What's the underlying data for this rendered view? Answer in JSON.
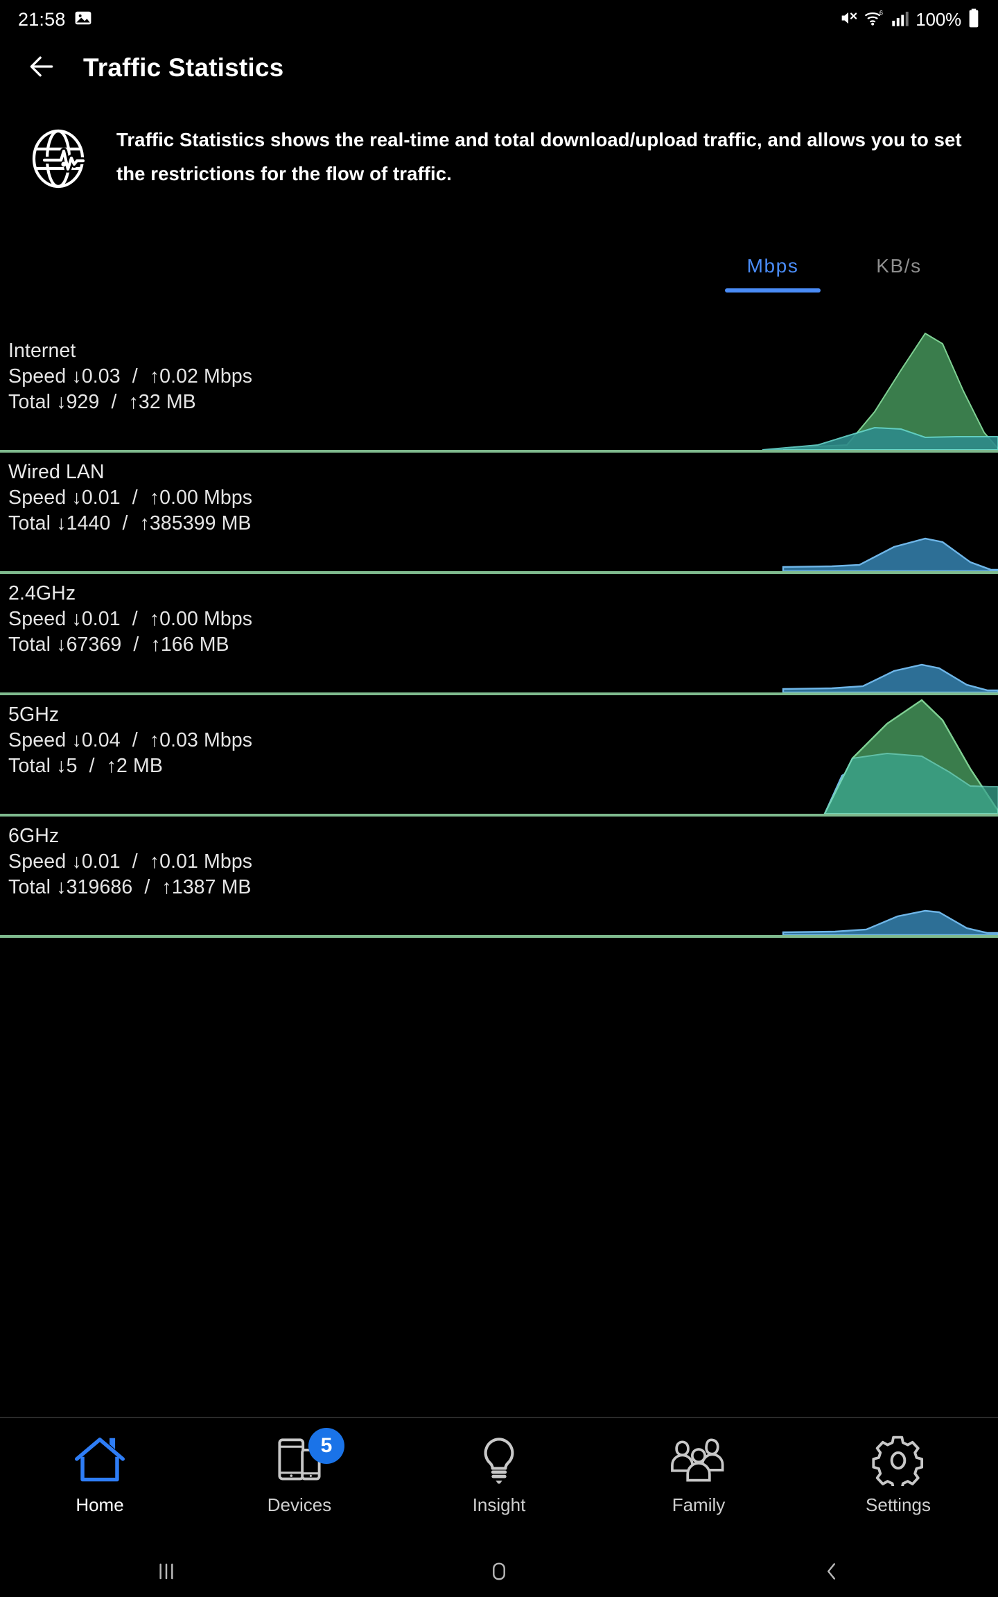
{
  "status_bar": {
    "time": "21:58",
    "left_icons": [
      "image-icon"
    ],
    "right_icons": [
      "mute-icon",
      "wifi-6-icon",
      "cellular-signal-icon"
    ],
    "battery_percent": "100%"
  },
  "app_bar": {
    "back_icon": "back-arrow-icon",
    "title": "Traffic Statistics"
  },
  "description": {
    "icon": "globe-traffic-icon",
    "text": "Traffic Statistics shows the real-time and total download/upload traffic, and allows you to set the restrictions for the flow of traffic."
  },
  "unit_tabs": {
    "active_color": "#4a8cf7",
    "inactive_color": "#8e8e8e",
    "items": [
      {
        "label": "Mbps",
        "active": true
      },
      {
        "label": "KB/s",
        "active": false
      }
    ]
  },
  "labels": {
    "speed": "Speed",
    "total": "Total",
    "separator": "/",
    "down_arrow": "↓",
    "up_arrow": "↑",
    "speed_unit": "Mbps",
    "total_unit": "MB"
  },
  "rows": [
    {
      "name": "Internet",
      "speed_down": "0.03",
      "speed_up": "0.02",
      "speed_unit": "Mbps",
      "total_down": "929",
      "total_up": "32",
      "total_unit": "MB"
    },
    {
      "name": "Wired LAN",
      "speed_down": "0.01",
      "speed_up": "0.00",
      "speed_unit": "Mbps",
      "total_down": "1440",
      "total_up": "385399",
      "total_unit": "MB"
    },
    {
      "name": "2.4GHz",
      "speed_down": "0.01",
      "speed_up": "0.00",
      "speed_unit": "Mbps",
      "total_down": "67369",
      "total_up": "166",
      "total_unit": "MB"
    },
    {
      "name": "5GHz",
      "speed_down": "0.04",
      "speed_up": "0.03",
      "speed_unit": "Mbps",
      "total_down": "5",
      "total_up": "2",
      "total_unit": "MB"
    },
    {
      "name": "6GHz",
      "speed_down": "0.01",
      "speed_up": "0.01",
      "speed_unit": "Mbps",
      "total_down": "319686",
      "total_up": "1387",
      "total_unit": "MB"
    }
  ],
  "chart_data": [
    {
      "type": "area",
      "title": "Internet",
      "x": [
        0,
        1,
        2,
        3,
        4,
        5,
        6,
        7,
        8,
        9,
        10,
        11,
        12
      ],
      "series": [
        {
          "name": "download",
          "color": "#3a7d4c",
          "values": [
            0,
            0,
            0,
            0,
            0,
            0,
            0,
            0,
            0.01,
            0.06,
            0.3,
            0.03,
            0.01
          ]
        },
        {
          "name": "upload",
          "color": "#2e8b8b",
          "values": [
            0,
            0,
            0,
            0,
            0,
            0,
            0,
            0,
            0.005,
            0.02,
            0.04,
            0.02,
            0.015
          ]
        }
      ],
      "ylim": [
        0,
        0.32
      ],
      "grid": false,
      "legend": "none"
    },
    {
      "type": "area",
      "title": "Wired LAN",
      "x": [
        0,
        1,
        2,
        3,
        4,
        5,
        6,
        7,
        8,
        9,
        10,
        11,
        12
      ],
      "series": [
        {
          "name": "download",
          "color": "#3a7d4c",
          "values": [
            0,
            0,
            0,
            0,
            0,
            0,
            0,
            0,
            0,
            0,
            0,
            0,
            0
          ]
        },
        {
          "name": "upload",
          "color": "#2d6f96",
          "values": [
            0.002,
            0.002,
            0.002,
            0.002,
            0.002,
            0.002,
            0.002,
            0.004,
            0.02,
            0.05,
            0.03,
            0.004,
            0.002
          ]
        }
      ],
      "ylim": [
        0,
        0.055
      ],
      "grid": false,
      "legend": "none"
    },
    {
      "type": "area",
      "title": "2.4GHz",
      "x": [
        0,
        1,
        2,
        3,
        4,
        5,
        6,
        7,
        8,
        9,
        10,
        11,
        12
      ],
      "series": [
        {
          "name": "download",
          "color": "#3a7d4c",
          "values": [
            0,
            0,
            0,
            0,
            0,
            0,
            0,
            0,
            0,
            0,
            0,
            0,
            0
          ]
        },
        {
          "name": "upload",
          "color": "#2d6f96",
          "values": [
            0.002,
            0.002,
            0.002,
            0.002,
            0.003,
            0.003,
            0.004,
            0.008,
            0.02,
            0.035,
            0.022,
            0.004,
            0.002
          ]
        }
      ],
      "ylim": [
        0,
        0.04
      ],
      "grid": false,
      "legend": "none"
    },
    {
      "type": "area",
      "title": "5GHz",
      "x": [
        0,
        1,
        2,
        3,
        4,
        5,
        6,
        7,
        8,
        9,
        10,
        11,
        12
      ],
      "series": [
        {
          "name": "download",
          "color": "#3a7d4c",
          "values": [
            0,
            0,
            0,
            0,
            0,
            0,
            0,
            0.01,
            0.09,
            0.17,
            0.22,
            0.1,
            0.01
          ]
        },
        {
          "name": "upload",
          "color": "#2d6f96",
          "values": [
            0,
            0,
            0,
            0,
            0,
            0,
            0,
            0.03,
            0.09,
            0.085,
            0.07,
            0.04,
            0.035
          ]
        }
      ],
      "ylim": [
        0,
        0.24
      ],
      "grid": false,
      "legend": "none"
    },
    {
      "type": "area",
      "title": "6GHz",
      "x": [
        0,
        1,
        2,
        3,
        4,
        5,
        6,
        7,
        8,
        9,
        10,
        11,
        12
      ],
      "series": [
        {
          "name": "download",
          "color": "#3a7d4c",
          "values": [
            0,
            0,
            0,
            0,
            0,
            0,
            0,
            0,
            0,
            0,
            0,
            0,
            0
          ]
        },
        {
          "name": "upload",
          "color": "#2d6f96",
          "values": [
            0.002,
            0.002,
            0.002,
            0.002,
            0.002,
            0.003,
            0.004,
            0.008,
            0.02,
            0.032,
            0.02,
            0.003,
            0.002
          ]
        }
      ],
      "ylim": [
        0,
        0.036
      ],
      "grid": false,
      "legend": "none"
    }
  ],
  "bottom_nav": {
    "active_color": "#2e7df6",
    "items": [
      {
        "label": "Home",
        "icon": "home-icon",
        "active": true,
        "badge": null
      },
      {
        "label": "Devices",
        "icon": "devices-icon",
        "active": false,
        "badge": "5"
      },
      {
        "label": "Insight",
        "icon": "lightbulb-icon",
        "active": false,
        "badge": null
      },
      {
        "label": "Family",
        "icon": "family-icon",
        "active": false,
        "badge": null
      },
      {
        "label": "Settings",
        "icon": "gear-icon",
        "active": false,
        "badge": null
      }
    ]
  },
  "system_nav": {
    "items": [
      {
        "icon": "recents-icon"
      },
      {
        "icon": "home-square-icon"
      },
      {
        "icon": "back-chevron-icon"
      }
    ]
  }
}
